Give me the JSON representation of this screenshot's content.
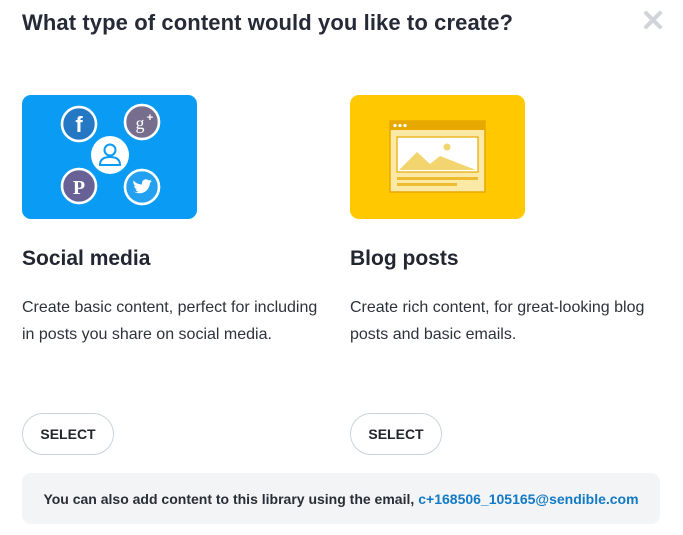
{
  "dialog": {
    "title": "What type of content would you like to create?",
    "close_icon": "close-icon"
  },
  "cards": [
    {
      "title": "Social media",
      "description": "Create basic content, perfect for including in posts you share on social media.",
      "button_label": "SELECT",
      "thumb_color": "#0a9cf5",
      "icons": [
        "facebook-icon",
        "google-plus-icon",
        "user-icon",
        "pinterest-icon",
        "twitter-icon"
      ]
    },
    {
      "title": "Blog posts",
      "description": "Create rich content, for great-looking blog posts and basic emails.",
      "button_label": "SELECT",
      "thumb_color": "#ffc800",
      "icons": [
        "browser-window-icon"
      ]
    }
  ],
  "footer": {
    "text": "You can also add content to this library using the email,",
    "email": "c+168506_105165@sendible.com",
    "email_color": "#1279c5"
  }
}
